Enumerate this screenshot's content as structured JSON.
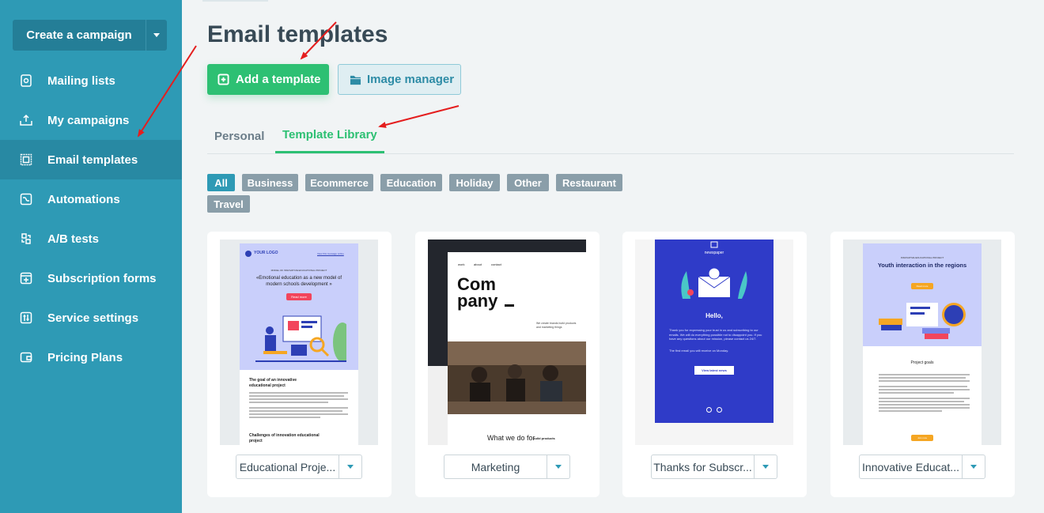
{
  "sidebar": {
    "create_label": "Create a campaign",
    "items": [
      {
        "label": "Mailing lists",
        "icon": "mailing-list-icon"
      },
      {
        "label": "My campaigns",
        "icon": "campaign-icon"
      },
      {
        "label": "Email templates",
        "icon": "template-icon",
        "active": true
      },
      {
        "label": "Automations",
        "icon": "automation-icon"
      },
      {
        "label": "A/B tests",
        "icon": "ab-test-icon"
      },
      {
        "label": "Subscription forms",
        "icon": "form-icon"
      },
      {
        "label": "Service settings",
        "icon": "settings-icon"
      },
      {
        "label": "Pricing Plans",
        "icon": "wallet-icon"
      }
    ]
  },
  "header": {
    "title": "Email templates"
  },
  "actions": {
    "add_label": "Add a template",
    "image_label": "Image manager"
  },
  "tabs": [
    {
      "label": "Personal"
    },
    {
      "label": "Template Library",
      "active": true
    }
  ],
  "filters": [
    "All",
    "Business",
    "Ecommerce",
    "Education",
    "Holiday",
    "Other",
    "Restaurant",
    "Travel"
  ],
  "active_filter": "All",
  "templates": [
    {
      "name": "Educational Proje...",
      "preview": {
        "logo": "YOUR LOGO",
        "view_online": "View this message online",
        "eyebrow": "MODEL OF INNOVATIVE EDUCATIONAL PROJECT",
        "headline": "«Emotional education as a new model of modern schools development »",
        "button": "Read more",
        "section1": "The goal of an innovative educational project",
        "section2": "Challenges of innovation educational project"
      }
    },
    {
      "name": "Marketing",
      "preview": {
        "nav": [
          "work",
          "about",
          "contact"
        ],
        "big1": "Com",
        "big2": "pany",
        "tagline": "We create brands build products and marketing things",
        "footer_left": "What we do for",
        "footer_right": "build products"
      }
    },
    {
      "name": "Thanks for Subscr...",
      "preview": {
        "brand": "newspaper",
        "greeting": "Hello,",
        "body": "Thank you for expressing your trust in us and subscribing to our emails. We will do everything possible not to disappoint you. If you have any questions about our mission, please contact us 24/7.",
        "body2": "The first email you will receive on Monday.",
        "button": "View latest news"
      }
    },
    {
      "name": "Innovative Educat...",
      "preview": {
        "eyebrow": "INNOVATIVE EDUCATIONAL PROJECT",
        "headline": "Youth interaction in the regions",
        "button": "Read more",
        "section": "Project goals",
        "button2": "Join now"
      }
    }
  ],
  "colors": {
    "sidebar": "#2e9ab5",
    "accent_green": "#2dc073",
    "annotation": "#e41e1e"
  }
}
